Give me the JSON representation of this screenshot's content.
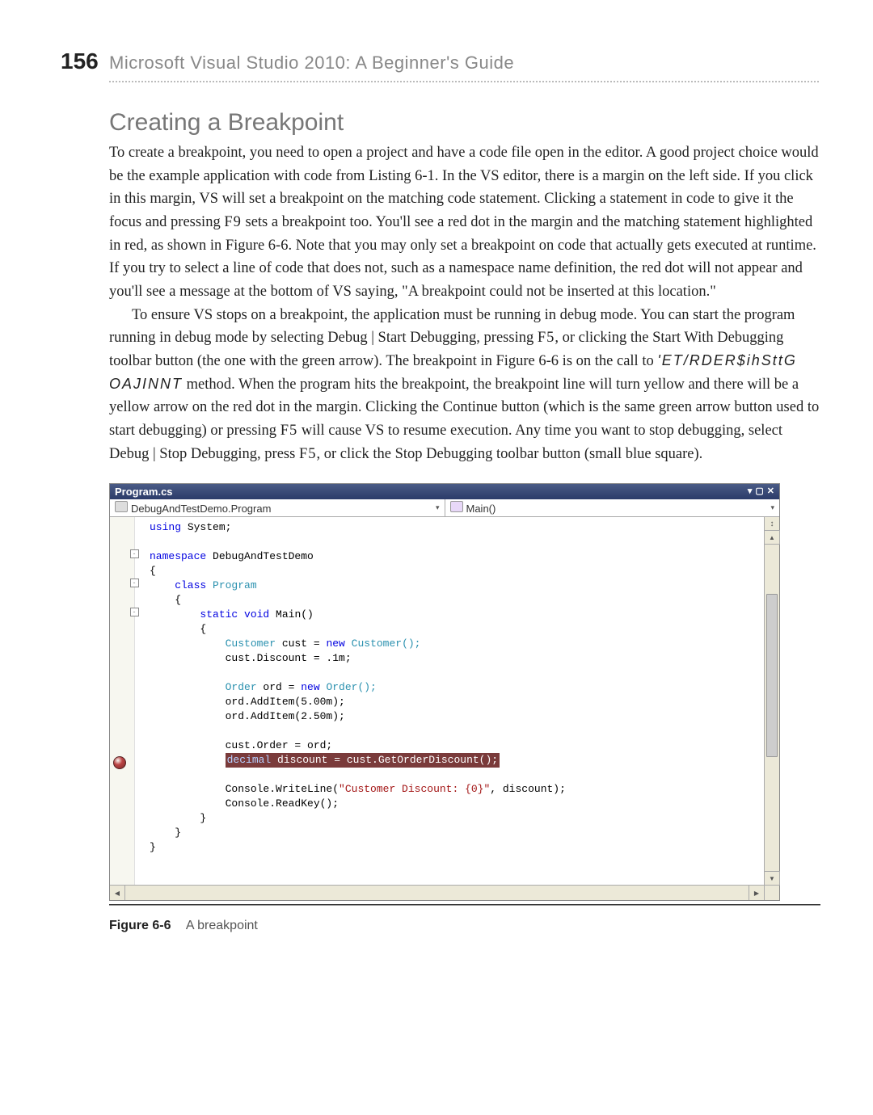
{
  "page_number": "156",
  "book_title": "Microsoft Visual Studio 2010: A Beginner's Guide",
  "section_title": "Creating a Breakpoint",
  "para1a": "To create a breakpoint, you need to open a project and have a code file open in the editor. A good project choice would be the example application with code from Listing 6-1. In the VS editor, there is a margin on the left side. If you click in this margin, VS will set a breakpoint on the matching code statement. Clicking a statement in code to give it the focus and pressing ",
  "para1_key1": "F9",
  "para1b": " sets a breakpoint too. You'll see a red dot in the margin and the matching statement highlighted in red, as shown in Figure 6-6. Note that you may only set a breakpoint on code that actually gets executed at runtime. If you try to select a line of code that does not, such as a namespace name definition, the red dot will not appear and you'll see a message at the bottom of VS saying, \"A breakpoint could not be inserted at this location.\"",
  "para2a": "To ensure VS stops on a breakpoint, the application must be running in debug mode. You can start the program running in debug mode by selecting Debug | Start Debugging, pressing ",
  "para2_key1": "F5",
  "para2b": ", or clicking the Start With Debugging toolbar button (the one with the green arrow). The breakpoint in Figure 6-6 is on the call to ",
  "para2_code": "'ET/RDER$ihSttG OAJINNT",
  "para2c": " method. When the program hits the breakpoint, the breakpoint line will turn yellow and there will be a yellow arrow on the red dot in the margin. Clicking the Continue button (which is the same green arrow button used to start debugging) or pressing ",
  "para2_key2": "F5",
  "para2d": " will cause VS to resume execution. Any time you want to stop debugging, select Debug | Stop Debugging, press ",
  "para2_key3": "F5",
  "para2e": ", or click the Stop Debugging toolbar button (small blue square).",
  "vs": {
    "tab_title": "Program.cs",
    "class_dropdown": "DebugAndTestDemo.Program",
    "method_dropdown": "Main()",
    "code": {
      "l1_using": "using",
      "l1_rest": " System;",
      "l3_ns": "namespace",
      "l3_rest": " DebugAndTestDemo",
      "l4": "{",
      "l5_cls": "    class",
      "l5_rest": " Program",
      "l6": "    {",
      "l7_sv": "        static void",
      "l7_rest": " Main()",
      "l8": "        {",
      "l9a": "            Customer",
      "l9b": " cust = ",
      "l9c": "new",
      "l9d": " Customer();",
      "l10": "            cust.Discount = .1m;",
      "l12a": "            Order",
      "l12b": " ord = ",
      "l12c": "new",
      "l12d": " Order();",
      "l13": "            ord.AddItem(5.00m);",
      "l14": "            ord.AddItem(2.50m);",
      "l16": "            cust.Order = ord;",
      "l17a": "decimal",
      "l17b": " discount = cust.GetOrderDiscount();",
      "l19a": "            Console.WriteLine(",
      "l19s": "\"Customer Discount: {0}\"",
      "l19b": ", discount);",
      "l20": "            Console.ReadKey();",
      "l21": "        }",
      "l22": "    }",
      "l23": "}"
    }
  },
  "figure": {
    "label": "Figure 6-6",
    "caption": "A breakpoint"
  }
}
